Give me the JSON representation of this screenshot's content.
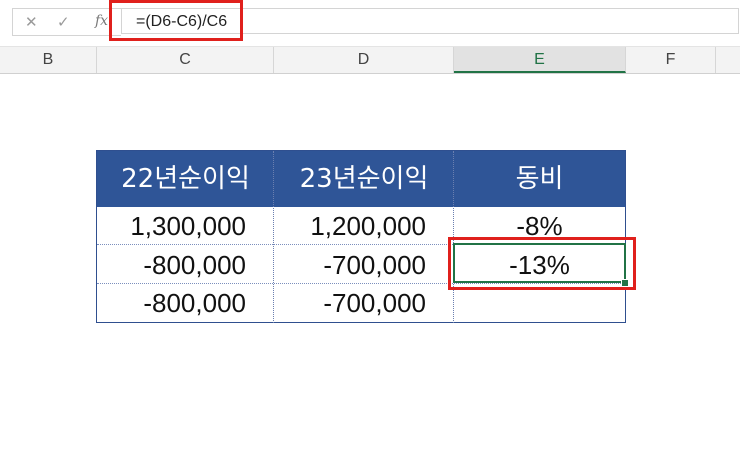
{
  "formula_bar": {
    "cancel_icon": "✕",
    "enter_icon": "✓",
    "fx_label": "fx",
    "formula": "=(D6-C6)/C6"
  },
  "columns": [
    "B",
    "C",
    "D",
    "E",
    "F"
  ],
  "selected_column": "E",
  "table": {
    "headers": [
      "22년순이익",
      "23년순이익",
      "동비"
    ],
    "rows": [
      [
        "1,300,000",
        "1,200,000",
        "-8%"
      ],
      [
        "-800,000",
        "-700,000",
        "-13%"
      ],
      [
        "-800,000",
        "-700,000",
        ""
      ]
    ]
  },
  "colors": {
    "header_fill": "#2f5597",
    "highlight": "#e0201c",
    "selection": "#217346"
  }
}
